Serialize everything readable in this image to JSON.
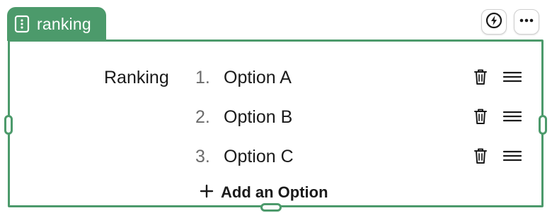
{
  "tab": {
    "icon": "form-field-icon",
    "label": "ranking"
  },
  "toolbar": {
    "logic_icon": "lightning-icon",
    "more_icon": "more-horizontal-icon"
  },
  "question": {
    "label": "Ranking",
    "options": [
      {
        "number": "1.",
        "text": "Option A"
      },
      {
        "number": "2.",
        "text": "Option B"
      },
      {
        "number": "3.",
        "text": "Option C"
      }
    ],
    "delete_icon": "trash-icon",
    "drag_icon": "drag-handle-icon",
    "add_label": "Add an Option",
    "add_icon": "plus-icon"
  },
  "colors": {
    "accent": "#4c9a6b",
    "text": "#1a1a1a",
    "muted": "#6b6b6b"
  }
}
